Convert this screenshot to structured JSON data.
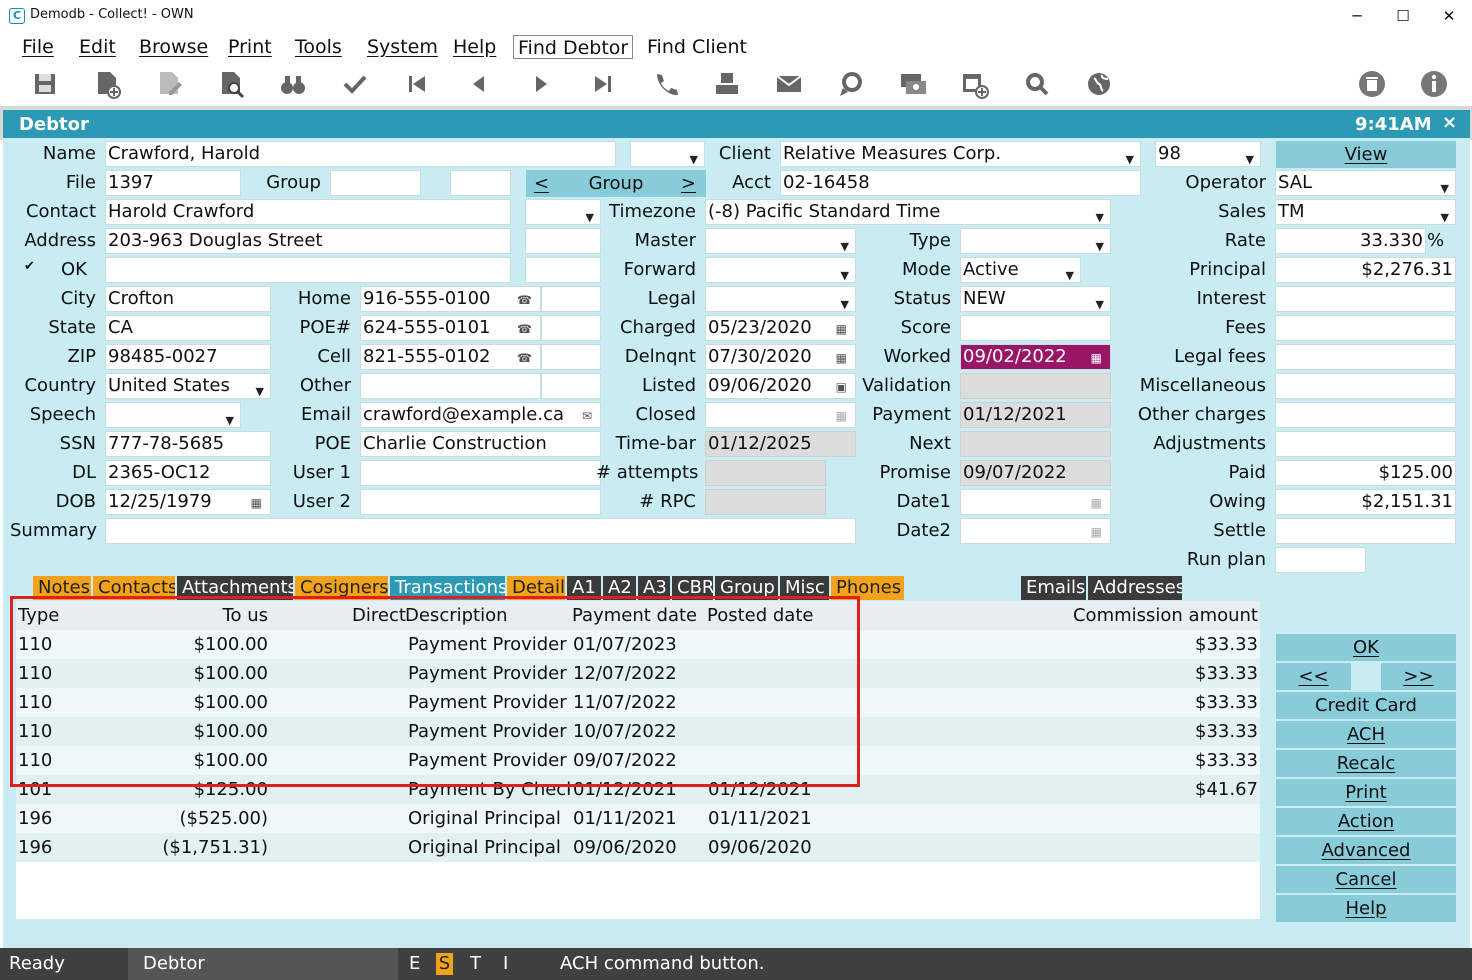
{
  "window": {
    "title": "Demodb - Collect! - OWN",
    "minimize": "─",
    "maximize": "☐",
    "close": "✕"
  },
  "menu": {
    "file": "File",
    "edit": "Edit",
    "browse": "Browse",
    "print": "Print",
    "tools": "Tools",
    "system": "System",
    "help": "Help",
    "find_debtor": "Find Debtor",
    "find_client": "Find Client"
  },
  "toolbar_icons": [
    "save-icon",
    "new-icon",
    "edit-icon",
    "preview-icon",
    "find-icon",
    "check-icon",
    "first-icon",
    "prev-icon",
    "next-icon",
    "last-icon",
    "phone-icon",
    "print-icon",
    "mail-icon",
    "chat-icon",
    "visa-icon",
    "calendar-add-icon",
    "search-icon",
    "globe-icon",
    "delete-icon",
    "info-icon"
  ],
  "header": {
    "title": "Debtor",
    "time": "9:41AM",
    "close": "×"
  },
  "form": {
    "name_label": "Name",
    "name": "Crawford, Harold",
    "file_label": "File",
    "file": "1397",
    "group_label": "Group",
    "group_nav": "Group",
    "group_prev": "<",
    "group_next": ">",
    "contact_label": "Contact",
    "contact": "Harold Crawford",
    "address_label": "Address",
    "address": "203-963 Douglas Street",
    "ok_check": "✔",
    "ok_label": "OK",
    "city_label": "City",
    "city": "Crofton",
    "state_label": "State",
    "state": "CA",
    "zip_label": "ZIP",
    "zip": "98485-0027",
    "country_label": "Country",
    "country": "United States",
    "speech_label": "Speech",
    "ssn_label": "SSN",
    "ssn": "777-78-5685",
    "dl_label": "DL",
    "dl": "2365-OC12",
    "dob_label": "DOB",
    "dob": "12/25/1979",
    "summary_label": "Summary",
    "home_label": "Home",
    "home": "916-555-0100",
    "poe_num_label": "POE#",
    "poe_num": "624-555-0101",
    "cell_label": "Cell",
    "cell": "821-555-0102",
    "other_label": "Other",
    "email_label": "Email",
    "email": "crawford@example.ca",
    "poe_label": "POE",
    "poe": "Charlie Construction",
    "user1_label": "User 1",
    "user2_label": "User 2",
    "client_label": "Client",
    "client": "Relative Measures Corp.",
    "client_num": "98",
    "view": "View",
    "acct_label": "Acct",
    "acct": "02-16458",
    "timezone_label": "Timezone",
    "timezone": "(-8) Pacific Standard Time",
    "master_label": "Master",
    "forward_label": "Forward",
    "legal_label": "Legal",
    "charged_label": "Charged",
    "charged": "05/23/2020",
    "delnqnt_label": "Delnqnt",
    "delnqnt": "07/30/2020",
    "listed_label": "Listed",
    "listed": "09/06/2020",
    "closed_label": "Closed",
    "timebar_label": "Time-bar",
    "timebar": "01/12/2025",
    "attempts_label": "# attempts",
    "rpc_label": "# RPC",
    "type_label": "Type",
    "mode_label": "Mode",
    "mode": "Active",
    "status_label": "Status",
    "status": "NEW",
    "score_label": "Score",
    "worked_label": "Worked",
    "worked": "09/02/2022",
    "validation_label": "Validation",
    "payment_label": "Payment",
    "payment": "01/12/2021",
    "next_label": "Next",
    "promise_label": "Promise",
    "promise": "09/07/2022",
    "date1_label": "Date1",
    "date2_label": "Date2",
    "operator_label": "Operator",
    "operator": "SAL",
    "sales_label": "Sales",
    "sales": "TM",
    "rate_label": "Rate",
    "rate": "33.330",
    "rate_unit": "%",
    "principal_label": "Principal",
    "principal": "$2,276.31",
    "interest_label": "Interest",
    "fees_label": "Fees",
    "legalfees_label": "Legal fees",
    "misc_label": "Miscellaneous",
    "othercharges_label": "Other charges",
    "adjustments_label": "Adjustments",
    "paid_label": "Paid",
    "paid": "$125.00",
    "owing_label": "Owing",
    "owing": "$2,151.31",
    "settle_label": "Settle",
    "runplan_label": "Run plan"
  },
  "tabs": {
    "notes": "Notes",
    "contacts": "Contacts",
    "attachments": "Attachments",
    "cosigners": "Cosigners",
    "transactions": "Transactions",
    "detail": "Detail",
    "a1": "A1",
    "a2": "A2",
    "a3": "A3",
    "cbr": "CBR",
    "group": "Group",
    "misc": "Misc",
    "phones": "Phones",
    "emails": "Emails",
    "addresses": "Addresses"
  },
  "grid": {
    "headers": {
      "type": "Type",
      "to_us": "To us",
      "direct": "Direct",
      "description": "Description",
      "payment_date": "Payment date",
      "posted_date": "Posted date",
      "commission": "Commission amount"
    },
    "rows": [
      {
        "type": "110",
        "to_us": "$100.00",
        "description": "Payment Provider ACH",
        "payment_date": "01/07/2023",
        "posted_date": "",
        "commission": "$33.33"
      },
      {
        "type": "110",
        "to_us": "$100.00",
        "description": "Payment Provider ACH",
        "payment_date": "12/07/2022",
        "posted_date": "",
        "commission": "$33.33"
      },
      {
        "type": "110",
        "to_us": "$100.00",
        "description": "Payment Provider ACH",
        "payment_date": "11/07/2022",
        "posted_date": "",
        "commission": "$33.33"
      },
      {
        "type": "110",
        "to_us": "$100.00",
        "description": "Payment Provider ACH",
        "payment_date": "10/07/2022",
        "posted_date": "",
        "commission": "$33.33"
      },
      {
        "type": "110",
        "to_us": "$100.00",
        "description": "Payment Provider ACH",
        "payment_date": "09/07/2022",
        "posted_date": "",
        "commission": "$33.33"
      },
      {
        "type": "101",
        "to_us": "$125.00",
        "description": "Payment By Check",
        "payment_date": "01/12/2021",
        "posted_date": "01/12/2021",
        "commission": "$41.67"
      },
      {
        "type": "196",
        "to_us": "($525.00)",
        "description": "Original Principal",
        "payment_date": "01/11/2021",
        "posted_date": "01/11/2021",
        "commission": ""
      },
      {
        "type": "196",
        "to_us": "($1,751.31)",
        "description": "Original Principal",
        "payment_date": "09/06/2020",
        "posted_date": "09/06/2020",
        "commission": ""
      }
    ]
  },
  "side_buttons": {
    "ok": "OK",
    "prev": "<<",
    "next": ">>",
    "credit_card": "Credit Card",
    "ach": "ACH",
    "recalc": "Recalc",
    "print": "Print",
    "action": "Action",
    "advanced": "Advanced",
    "cancel": "Cancel",
    "help": "Help"
  },
  "statusbar": {
    "ready": "Ready",
    "context": "Debtor",
    "e": "E",
    "s": "S",
    "t": "T",
    "i": "I",
    "message": "ACH command button."
  },
  "colors": {
    "header": "#2d9ab4",
    "form_bg": "#c8ecf2",
    "highlight": "#9b1566",
    "tab_orange": "#f2a21b",
    "tab_dark": "#3a3a3a",
    "button": "#89ccd9",
    "annotation": "#e0201f"
  }
}
